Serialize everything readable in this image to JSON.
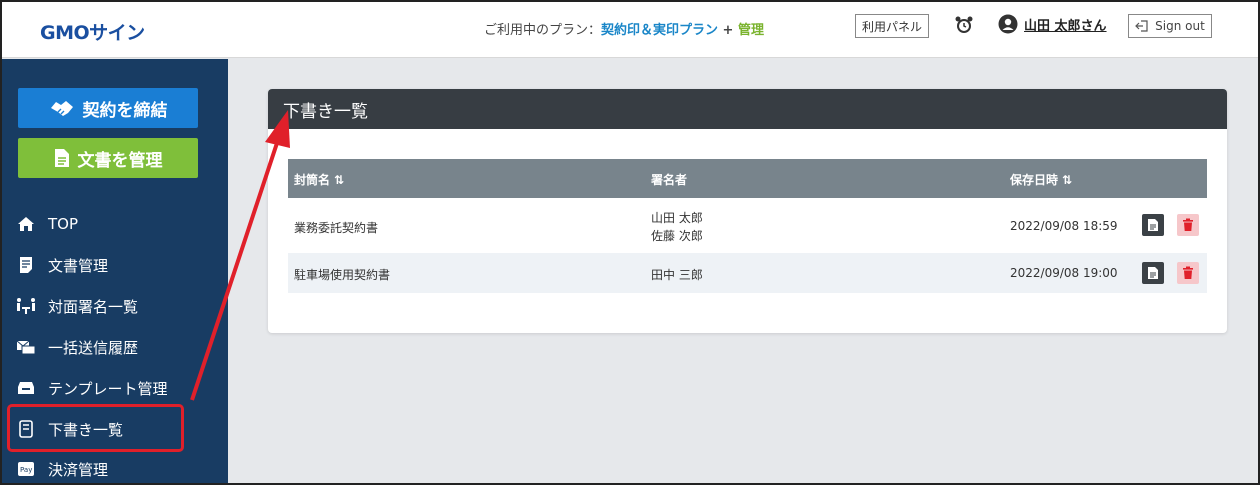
{
  "header": {
    "logo": "GMOサイン",
    "plan_prefix": "ご利用中のプラン：",
    "plan_name": "契約印＆実印プラン",
    "plan_plus": " + ",
    "plan_admin": "管理",
    "panel_button": "利用パネル",
    "user_name": "山田 太郎さん",
    "signout": "Sign out"
  },
  "sidebar": {
    "contract_button": "契約を締結",
    "manage_button": "文書を管理",
    "items": [
      {
        "label": "TOP",
        "icon": "home-icon"
      },
      {
        "label": "文書管理",
        "icon": "document-list-icon"
      },
      {
        "label": "対面署名一覧",
        "icon": "face-to-face-icon"
      },
      {
        "label": "一括送信履歴",
        "icon": "bulk-send-icon"
      },
      {
        "label": "テンプレート管理",
        "icon": "template-icon"
      },
      {
        "label": "下書き一覧",
        "icon": "draft-icon"
      },
      {
        "label": "決済管理",
        "icon": "pay-icon"
      }
    ]
  },
  "main": {
    "title": "下書き一覧",
    "columns": [
      "封筒名 ⇅",
      "署名者",
      "保存日時 ⇅"
    ],
    "rows": [
      {
        "name": "業務委託契約書",
        "signer1": "山田 太郎",
        "signer2": "佐藤 次郎",
        "date": "2022/09/08 18:59"
      },
      {
        "name": "駐車場使用契約書",
        "signer1": "田中 三郎",
        "signer2": "",
        "date": "2022/09/08 19:00"
      }
    ]
  },
  "colors": {
    "sidebar": "#183c63",
    "primary": "#1a7ed4",
    "secondary": "#7fbf3a",
    "highlight": "#e0202a"
  }
}
